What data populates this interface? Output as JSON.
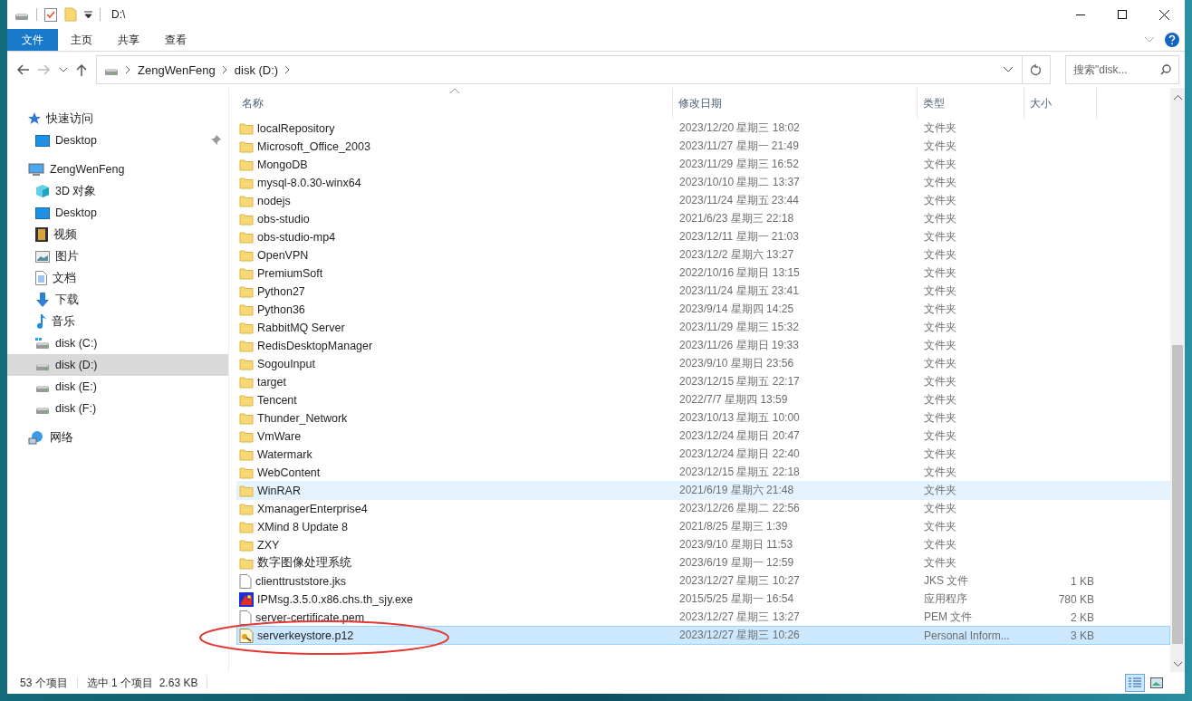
{
  "window": {
    "title": "D:\\"
  },
  "ribbon_tabs": [
    {
      "label": "文件",
      "selected": true
    },
    {
      "label": "主页",
      "selected": false
    },
    {
      "label": "共享",
      "selected": false
    },
    {
      "label": "查看",
      "selected": false
    }
  ],
  "address": {
    "crumbs": [
      "ZengWenFeng",
      "disk (D:)"
    ]
  },
  "search": {
    "placeholder": "搜索\"disk..."
  },
  "sidebar": {
    "items": [
      {
        "label": "快速访问",
        "kind": "star",
        "selected": false,
        "children": [
          {
            "label": "Desktop",
            "kind": "desktop",
            "selected": false,
            "pinned": true
          }
        ]
      },
      {
        "label": "ZengWenFeng",
        "kind": "computer",
        "selected": false,
        "children": [
          {
            "label": "3D 对象",
            "kind": "cube",
            "selected": false
          },
          {
            "label": "Desktop",
            "kind": "desktop",
            "selected": false
          },
          {
            "label": "视频",
            "kind": "video",
            "selected": false
          },
          {
            "label": "图片",
            "kind": "image",
            "selected": false
          },
          {
            "label": "文档",
            "kind": "doc",
            "selected": false
          },
          {
            "label": "下载",
            "kind": "download",
            "selected": false
          },
          {
            "label": "音乐",
            "kind": "music",
            "selected": false
          },
          {
            "label": "disk (C:)",
            "kind": "sysdrive",
            "selected": false
          },
          {
            "label": "disk (D:)",
            "kind": "drive",
            "selected": true
          },
          {
            "label": "disk (E:)",
            "kind": "drive",
            "selected": false
          },
          {
            "label": "disk (F:)",
            "kind": "drive",
            "selected": false
          }
        ]
      },
      {
        "label": "网络",
        "kind": "network",
        "selected": false
      }
    ]
  },
  "table": {
    "columns": [
      "名称",
      "修改日期",
      "类型",
      "大小"
    ],
    "rows": [
      {
        "kind": "folder",
        "name": "localRepository",
        "date": "2023/12/20 星期三 18:02",
        "type": "文件夹",
        "selected": false,
        "hovered": false
      },
      {
        "kind": "folder",
        "name": "Microsoft_Office_2003",
        "date": "2023/11/27 星期一 21:49",
        "type": "文件夹",
        "selected": false,
        "hovered": false
      },
      {
        "kind": "folder",
        "name": "MongoDB",
        "date": "2023/11/29 星期三 16:52",
        "type": "文件夹",
        "selected": false,
        "hovered": false
      },
      {
        "kind": "folder",
        "name": "mysql-8.0.30-winx64",
        "date": "2023/10/10 星期二 13:37",
        "type": "文件夹",
        "selected": false,
        "hovered": false
      },
      {
        "kind": "folder",
        "name": "nodejs",
        "date": "2023/11/24 星期五 23:44",
        "type": "文件夹",
        "selected": false,
        "hovered": false
      },
      {
        "kind": "folder",
        "name": "obs-studio",
        "date": "2021/6/23 星期三 22:18",
        "type": "文件夹",
        "selected": false,
        "hovered": false
      },
      {
        "kind": "folder",
        "name": "obs-studio-mp4",
        "date": "2023/12/11 星期一 21:03",
        "type": "文件夹",
        "selected": false,
        "hovered": false
      },
      {
        "kind": "folder",
        "name": "OpenVPN",
        "date": "2023/12/2 星期六 13:27",
        "type": "文件夹",
        "selected": false,
        "hovered": false
      },
      {
        "kind": "folder",
        "name": "PremiumSoft",
        "date": "2022/10/16 星期日 13:15",
        "type": "文件夹",
        "selected": false,
        "hovered": false
      },
      {
        "kind": "folder",
        "name": "Python27",
        "date": "2023/11/24 星期五 23:41",
        "type": "文件夹",
        "selected": false,
        "hovered": false
      },
      {
        "kind": "folder",
        "name": "Python36",
        "date": "2023/9/14 星期四 14:25",
        "type": "文件夹",
        "selected": false,
        "hovered": false
      },
      {
        "kind": "folder",
        "name": "RabbitMQ Server",
        "date": "2023/11/29 星期三 15:32",
        "type": "文件夹",
        "selected": false,
        "hovered": false
      },
      {
        "kind": "folder",
        "name": "RedisDesktopManager",
        "date": "2023/11/26 星期日 19:33",
        "type": "文件夹",
        "selected": false,
        "hovered": false
      },
      {
        "kind": "folder",
        "name": "SogouInput",
        "date": "2023/9/10 星期日 23:56",
        "type": "文件夹",
        "selected": false,
        "hovered": false
      },
      {
        "kind": "folder",
        "name": "target",
        "date": "2023/12/15 星期五 22:17",
        "type": "文件夹",
        "selected": false,
        "hovered": false
      },
      {
        "kind": "folder",
        "name": "Tencent",
        "date": "2022/7/7 星期四 13:59",
        "type": "文件夹",
        "selected": false,
        "hovered": false
      },
      {
        "kind": "folder",
        "name": "Thunder_Network",
        "date": "2023/10/13 星期五 10:00",
        "type": "文件夹",
        "selected": false,
        "hovered": false
      },
      {
        "kind": "folder",
        "name": "VmWare",
        "date": "2023/12/24 星期日 20:47",
        "type": "文件夹",
        "selected": false,
        "hovered": false
      },
      {
        "kind": "folder",
        "name": "Watermark",
        "date": "2023/12/24 星期日 22:40",
        "type": "文件夹",
        "selected": false,
        "hovered": false
      },
      {
        "kind": "folder",
        "name": "WebContent",
        "date": "2023/12/15 星期五 22:18",
        "type": "文件夹",
        "selected": false,
        "hovered": false
      },
      {
        "kind": "folder",
        "name": "WinRAR",
        "date": "2021/6/19 星期六 21:48",
        "type": "文件夹",
        "selected": false,
        "hovered": true
      },
      {
        "kind": "folder",
        "name": "XmanagerEnterprise4",
        "date": "2023/12/26 星期二 22:56",
        "type": "文件夹",
        "selected": false,
        "hovered": false
      },
      {
        "kind": "folder",
        "name": "XMind 8 Update 8",
        "date": "2021/8/25 星期三 1:39",
        "type": "文件夹",
        "selected": false,
        "hovered": false
      },
      {
        "kind": "folder",
        "name": "ZXY",
        "date": "2023/9/10 星期日 11:53",
        "type": "文件夹",
        "selected": false,
        "hovered": false
      },
      {
        "kind": "folder",
        "name": "数字图像处理系统",
        "date": "2023/6/19 星期一 12:59",
        "type": "文件夹",
        "selected": false,
        "hovered": false
      },
      {
        "kind": "file",
        "name": "clienttruststore.jks",
        "date": "2023/12/27 星期三 10:27",
        "type": "JKS 文件",
        "size": "1 KB",
        "selected": false,
        "hovered": false
      },
      {
        "kind": "exe",
        "name": "IPMsg.3.5.0.x86.chs.th_sjy.exe",
        "date": "2015/5/25 星期一 16:54",
        "type": "应用程序",
        "size": "780 KB",
        "selected": false,
        "hovered": false
      },
      {
        "kind": "file",
        "name": "server-certificate.pem",
        "date": "2023/12/27 星期三 13:27",
        "type": "PEM 文件",
        "size": "2 KB",
        "selected": false,
        "hovered": false
      },
      {
        "kind": "cert",
        "name": "serverkeystore.p12",
        "date": "2023/12/27 星期三 10:26",
        "type": "Personal Inform...",
        "size": "3 KB",
        "selected": true,
        "hovered": false
      }
    ]
  },
  "status_bar": {
    "count": "53 个项目",
    "selection": "选中 1 个项目  2.63 KB"
  }
}
